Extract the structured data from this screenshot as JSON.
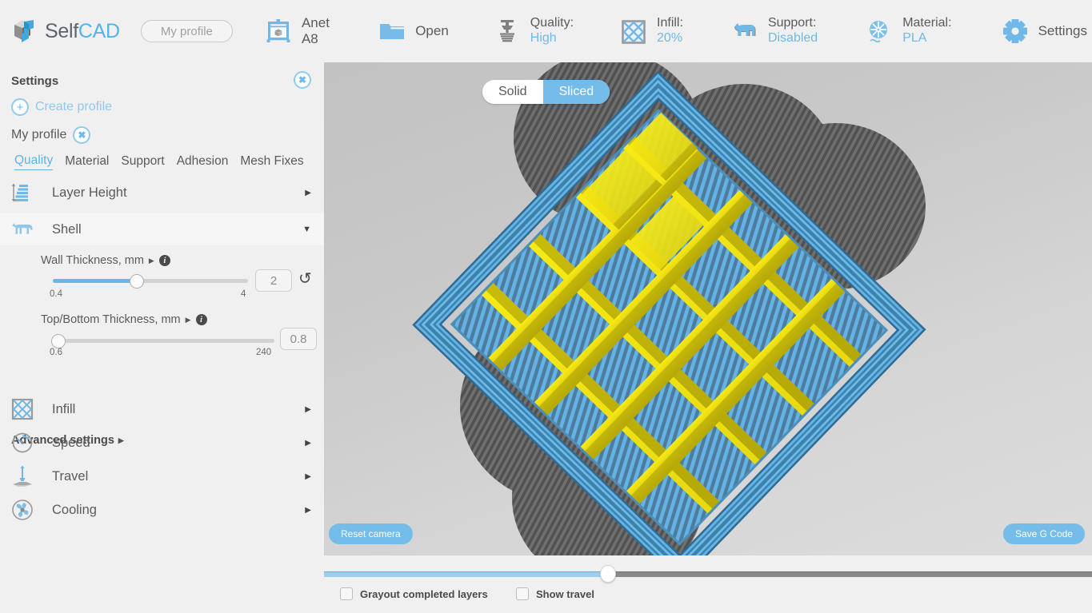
{
  "brand": {
    "self": "Self",
    "cad": "CAD",
    "logo_icon": "selfcad-logo-icon"
  },
  "header": {
    "profile_placeholder": "My profile",
    "items": [
      {
        "id": "printer",
        "icon": "printer-icon",
        "label": "Anet A8",
        "single": true
      },
      {
        "id": "open",
        "icon": "folder-icon",
        "label": "Open",
        "single": true
      },
      {
        "id": "quality",
        "icon": "quality-icon",
        "label": "Quality:",
        "value": "High"
      },
      {
        "id": "infill",
        "icon": "infill-icon",
        "label": "Infill:",
        "value": "20%"
      },
      {
        "id": "support",
        "icon": "support-dog-icon",
        "label": "Support:",
        "value": "Disabled"
      },
      {
        "id": "material",
        "icon": "filament-spool-icon",
        "label": "Material:",
        "value": "PLA"
      },
      {
        "id": "settings",
        "icon": "gear-icon",
        "label": "Settings",
        "single": true
      }
    ]
  },
  "sidebar": {
    "title": "Settings",
    "close_icon": "close-circle-icon",
    "create_profile": {
      "label": "Create profile",
      "icon": "plus-circle-icon"
    },
    "profile": {
      "name": "My profile",
      "remove_icon": "close-circle-icon"
    },
    "tabs": [
      {
        "label": "Quality",
        "active": true
      },
      {
        "label": "Material",
        "active": false
      },
      {
        "label": "Support",
        "active": false
      },
      {
        "label": "Adhesion",
        "active": false
      },
      {
        "label": "Mesh Fixes",
        "active": false
      }
    ],
    "sections": [
      {
        "id": "layer-height",
        "label": "Layer Height",
        "icon": "layer-height-icon",
        "expanded": false,
        "arrow": "▶"
      },
      {
        "id": "shell",
        "label": "Shell",
        "icon": "shell-dog-icon",
        "expanded": true,
        "arrow": "▼"
      },
      {
        "id": "infill",
        "label": "Infill",
        "icon": "infill-grid-icon",
        "expanded": false,
        "arrow": "▶"
      },
      {
        "id": "speed",
        "label": "Speed",
        "icon": "speedometer-icon",
        "expanded": false,
        "arrow": "▶"
      },
      {
        "id": "travel",
        "label": "Travel",
        "icon": "travel-nozzle-icon",
        "expanded": false,
        "arrow": "▶"
      },
      {
        "id": "cooling",
        "label": "Cooling",
        "icon": "fan-icon",
        "expanded": false,
        "arrow": "▶"
      }
    ],
    "fields": [
      {
        "id": "wall-thickness",
        "label": "Wall Thickness, mm",
        "info_icon": "info-icon",
        "expand_icon": "triangle-right-icon",
        "value": "2",
        "min_label": "0.4",
        "max_label": "4",
        "fill_percent": 43,
        "has_reset": true,
        "reset_icon": "reset-icon"
      },
      {
        "id": "top-bottom-thickness",
        "label": "Top/Bottom Thickness, mm",
        "info_icon": "info-icon",
        "expand_icon": "triangle-right-icon",
        "value": "0.8",
        "min_label": "0.6",
        "max_label": "240",
        "fill_percent": 1,
        "has_reset": false
      }
    ],
    "advanced": {
      "label": "Advanced settings",
      "icon": "triangle-right-icon"
    }
  },
  "viewport": {
    "view_modes": [
      {
        "label": "Solid",
        "active": false
      },
      {
        "label": "Sliced",
        "active": true
      }
    ],
    "reset_camera_label": "Reset camera",
    "save_gcode_label": "Save G Code"
  },
  "footer": {
    "layer_slider": {
      "value_percent": 37
    },
    "checkboxes": [
      {
        "id": "grayout",
        "label": "Grayout completed layers",
        "checked": false
      },
      {
        "id": "travel",
        "label": "Show travel",
        "checked": false
      }
    ]
  },
  "colors": {
    "accent_blue": "#6fb8e8",
    "toggle_active": "#74bdea",
    "panel_bg": "#f0f0f0",
    "text": "#5a5a5a",
    "extrusion_wall": "#5aa8e0",
    "extrusion_infill": "#f5e71a",
    "skirt_gray": "#5c5c5c"
  }
}
